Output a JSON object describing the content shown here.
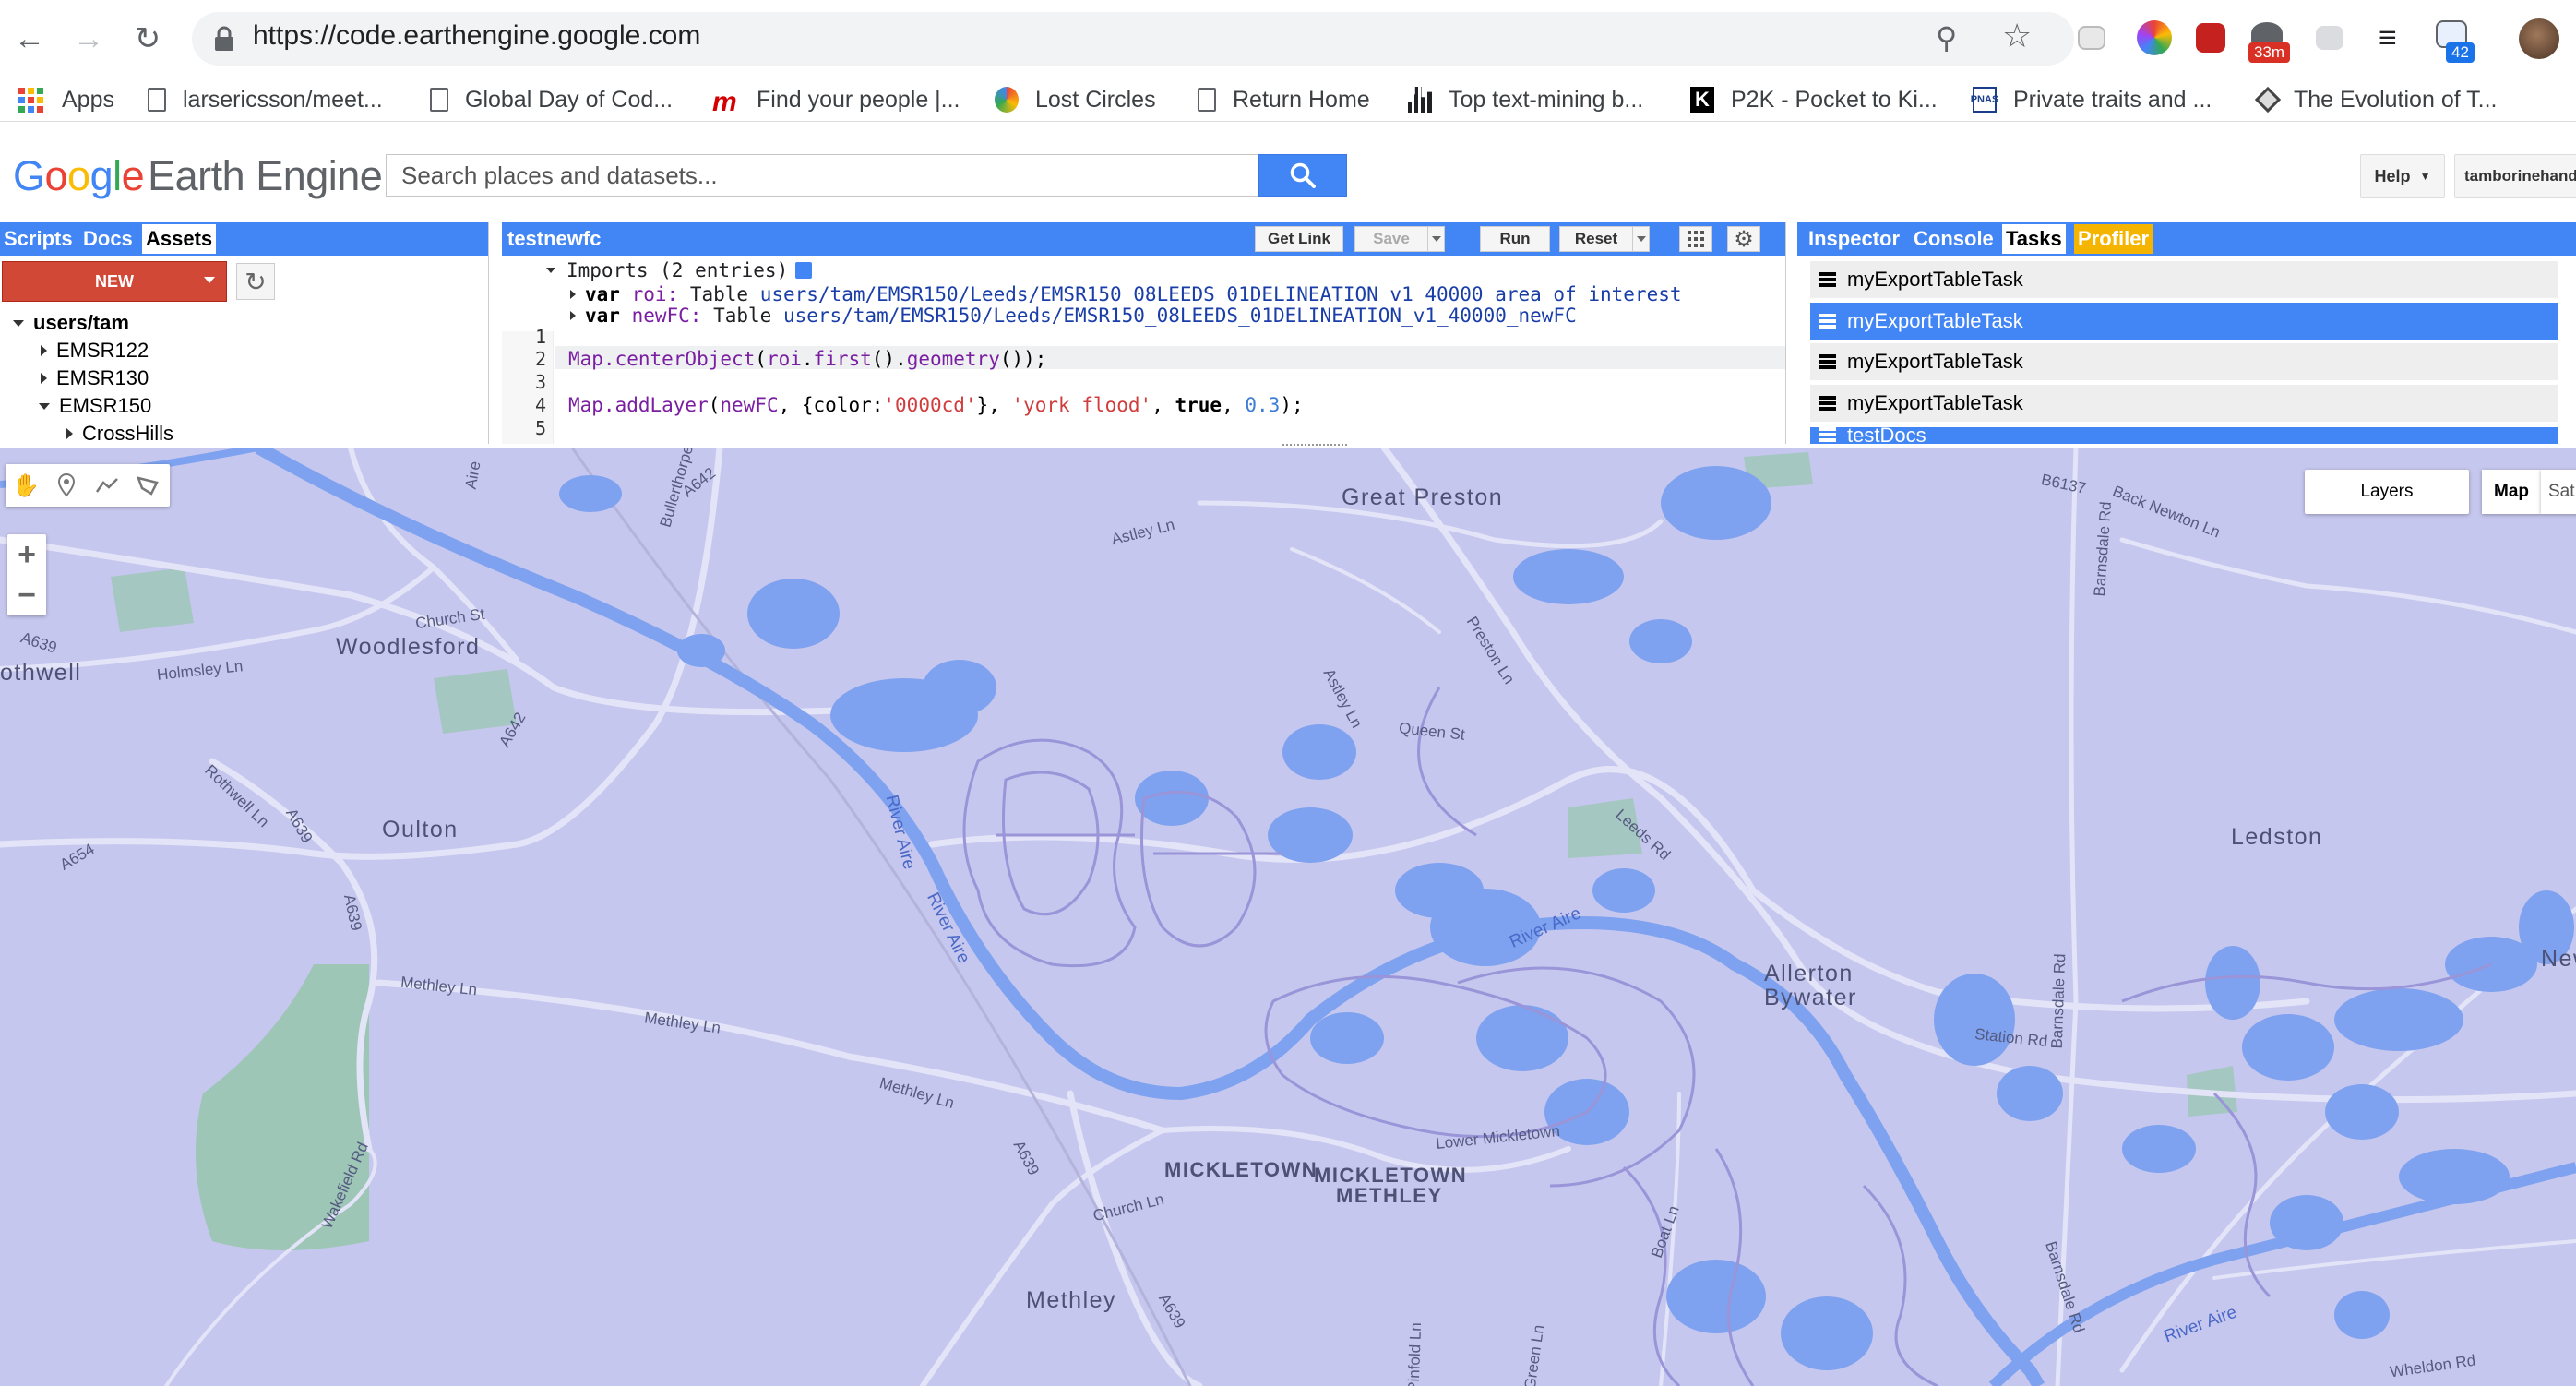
{
  "browser": {
    "url": "https://code.earthengine.google.com",
    "extensions": {
      "badge_timer": "33m",
      "badge_count": "42"
    },
    "bookmarks": [
      "Apps",
      "larsericsson/meet...",
      "Global Day of Cod...",
      "Find your people |...",
      "Lost Circles",
      "Return Home",
      "Top text-mining b...",
      "P2K - Pocket to Ki...",
      "Private traits and ...",
      "The Evolution of T..."
    ]
  },
  "header": {
    "logo_google": "Google",
    "logo_product": "Earth Engine",
    "search_placeholder": "Search places and datasets...",
    "help_label": "Help",
    "user_label": "tamborinehands"
  },
  "left_panel": {
    "tabs": [
      "Scripts",
      "Docs",
      "Assets"
    ],
    "active_tab": "Assets",
    "new_label": "NEW",
    "tree": [
      {
        "label": "users/tam",
        "level": 0,
        "expanded": true
      },
      {
        "label": "EMSR122",
        "level": 1,
        "expanded": false
      },
      {
        "label": "EMSR130",
        "level": 1,
        "expanded": false
      },
      {
        "label": "EMSR150",
        "level": 1,
        "expanded": true
      },
      {
        "label": "CrossHills",
        "level": 2,
        "expanded": false
      }
    ]
  },
  "editor": {
    "script_name": "testnewfc",
    "buttons": {
      "get_link": "Get Link",
      "save": "Save",
      "run": "Run",
      "reset": "Reset"
    },
    "imports_header": "Imports (2 entries)",
    "imports": [
      {
        "keyword": "var",
        "name": "roi:",
        "type": "Table",
        "path": "users/tam/EMSR150/Leeds/EMSR150_08LEEDS_01DELINEATION_v1_40000_area_of_interest"
      },
      {
        "keyword": "var",
        "name": "newFC:",
        "type": "Table",
        "path": "users/tam/EMSR150/Leeds/EMSR150_08LEEDS_01DELINEATION_v1_40000_newFC"
      }
    ],
    "line_numbers": [
      "1",
      "2",
      "3",
      "4",
      "5"
    ],
    "code": {
      "line2_a": "Map.centerObject",
      "line2_b": "(",
      "line2_c": "roi",
      "line2_d": ".",
      "line2_e": "first",
      "line2_f": "().",
      "line2_g": "geometry",
      "line2_h": "());",
      "line4_a": "Map.addLayer",
      "line4_b": "(",
      "line4_c": "newFC",
      "line4_d": ", {color:",
      "line4_e": "'0000cd'",
      "line4_f": "}, ",
      "line4_g": "'york flood'",
      "line4_h": ", ",
      "line4_i": "true",
      "line4_j": ", ",
      "line4_k": "0.3",
      "line4_l": ");"
    }
  },
  "right_panel": {
    "tabs": [
      "Inspector",
      "Console",
      "Tasks",
      "Profiler"
    ],
    "active_tab": "Tasks",
    "tasks": [
      {
        "name": "myExportTableTask",
        "selected": false
      },
      {
        "name": "myExportTableTask",
        "selected": true
      },
      {
        "name": "myExportTableTask",
        "selected": false
      },
      {
        "name": "myExportTableTask",
        "selected": false
      }
    ],
    "partial_task": "testDocs"
  },
  "map": {
    "layers_label": "Layers",
    "map_type_map": "Map",
    "map_type_sat": "Sat",
    "zoom_in": "+",
    "zoom_out": "−",
    "places": {
      "great_preston": "Great Preston",
      "woodlesford": "Woodlesford",
      "othwell": "othwell",
      "oulton": "Oulton",
      "ledston": "Ledston",
      "allerton": "Allerton",
      "bywater": "Bywater",
      "mickletown": "MICKLETOWN",
      "mickletown_methley_1": "MICKLETOWN",
      "mickletown_methley_2": "METHLEY",
      "methley": "Methley",
      "new_edge": "New"
    },
    "roads": {
      "a642_top": "A642",
      "bullerthorpe": "Bullerthorpe",
      "astley_ln_top": "Astley Ln",
      "b6137": "B6137",
      "back_newton_ln": "Back Newton Ln",
      "barnsdale_rd_top": "Barnsdale Rd",
      "preston_ln": "Preston Ln",
      "astley_ln": "Astley Ln",
      "queen_st": "Queen St",
      "church_st": "Church St",
      "a639_left": "A639",
      "holmsley_ln": "Holmsley Ln",
      "a642_mid": "A642",
      "rothwell_ln": "Rothwell Ln",
      "a654": "A654",
      "a639_mid": "A639",
      "a639_down": "A639",
      "leeds_rd": "Leeds Rd",
      "methley_ln_1": "Methley Ln",
      "methley_ln_2": "Methley Ln",
      "methley_ln_3": "Methley Ln",
      "a639_bottom": "A639",
      "a639_bottom2": "A639",
      "church_ln": "Church Ln",
      "lower_mickletown": "Lower Mickletown",
      "station_rd": "Station Rd",
      "barnsdale_rd_mid": "Barnsdale Rd",
      "barnsdale_rd_bottom": "Barnsdale Rd",
      "boat_ln": "Boat Ln",
      "wakefield_rd": "Wakefield Rd",
      "pinfold_ln": "Pinfold Ln",
      "green_ln": "Green Ln",
      "wheldon_rd": "Wheldon Rd",
      "a_edge": "Aire"
    },
    "rivers": {
      "river_aire_1": "River Aire",
      "river_aire_2": "River Aire",
      "river_aire_3": "River Aire",
      "river_aire_4": "River Aire"
    },
    "colors": {
      "land": "#c6c7ee",
      "water": "#7ea2ef",
      "road": "#dcdcf5",
      "park": "#8fc6a3",
      "flood_outline": "#9a94d8"
    }
  }
}
